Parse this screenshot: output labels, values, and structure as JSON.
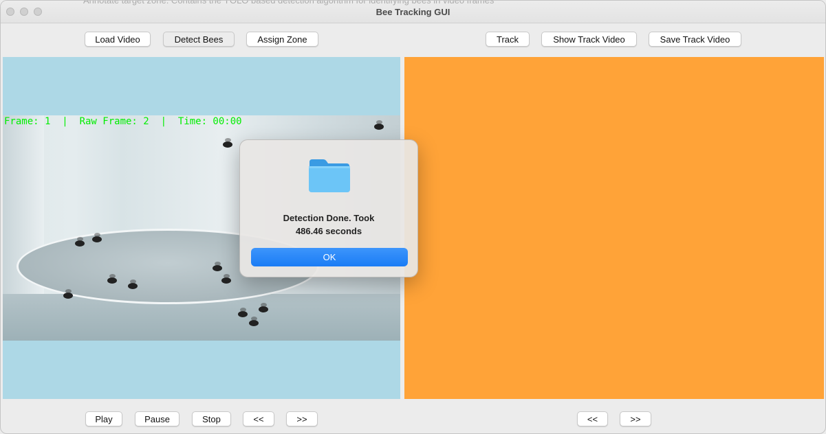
{
  "window": {
    "title": "Bee Tracking GUI",
    "background_text": "Annotate target zone. Contains the YOLO based detection algorithm for identifying bees in video frames"
  },
  "toolbar_left": {
    "load_video": "Load Video",
    "detect_bees": "Detect Bees",
    "assign_zone": "Assign Zone"
  },
  "toolbar_right": {
    "track": "Track",
    "show_track_video": "Show Track Video",
    "save_track_video": "Save Track Video"
  },
  "video_overlay": "Frame: 1  |  Raw Frame: 2  |  Time: 00:00",
  "playback_left": {
    "play": "Play",
    "pause": "Pause",
    "stop": "Stop",
    "prev": "<<",
    "next": ">>"
  },
  "playback_right": {
    "prev": "<<",
    "next": ">>"
  },
  "dialog": {
    "icon": "folder-icon",
    "message_line1": "Detection Done. Took",
    "message_line2": "486.46 seconds",
    "ok_label": "OK"
  },
  "colors": {
    "left_pane": "#add8e6",
    "right_pane": "#ffa338",
    "overlay_text": "#00ee00",
    "ok_button": "#1a7cf5"
  }
}
